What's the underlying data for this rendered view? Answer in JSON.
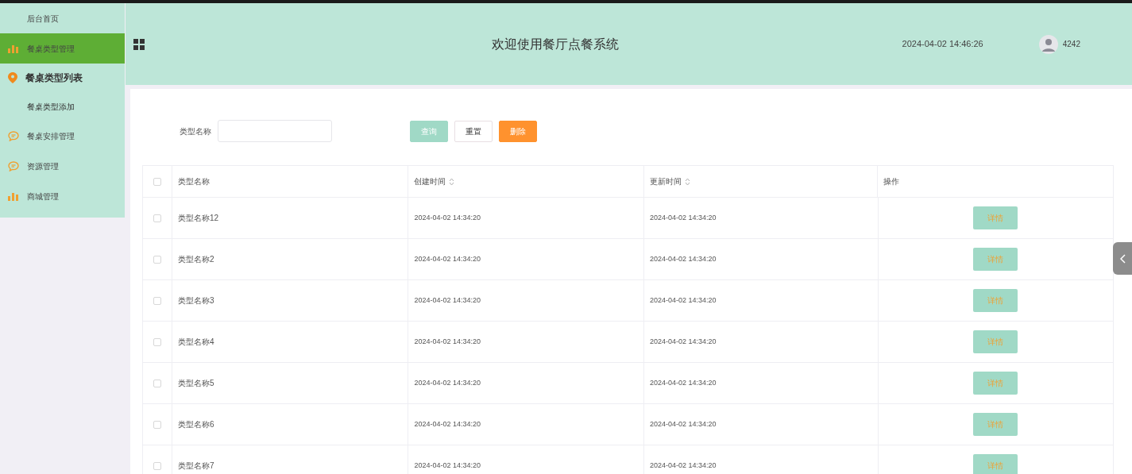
{
  "sidebar": {
    "items": [
      {
        "label": "后台首页",
        "selected": false
      },
      {
        "label": "餐桌类型管理",
        "selected": true,
        "children": [
          {
            "label": "餐桌类型列表",
            "selected": true
          },
          {
            "label": "餐桌类型添加",
            "selected": false
          }
        ]
      },
      {
        "label": "餐桌安排管理",
        "selected": false
      },
      {
        "label": "资源管理",
        "selected": false
      },
      {
        "label": "商城管理",
        "selected": false
      }
    ]
  },
  "header": {
    "title": "欢迎使用餐厅点餐系统",
    "datetime": "2024-04-02 14:46:26",
    "username": "4242"
  },
  "search": {
    "label": "类型名称",
    "buttons": [
      {
        "label": "查询",
        "kind": "query"
      },
      {
        "label": "重置",
        "kind": "reset"
      },
      {
        "label": "删除",
        "kind": "delete"
      }
    ]
  },
  "table": {
    "select_all": {
      "checked": false
    },
    "columns": [
      {
        "label": "类型名称",
        "sortable": false
      },
      {
        "label": "创建时间",
        "sortable": true
      },
      {
        "label": "更新时间",
        "sortable": true
      },
      {
        "label": "操作",
        "sortable": false
      }
    ],
    "rows": [
      {
        "checked": false,
        "name": "类型名称12",
        "created": "2024-04-02 14:34:20",
        "updated": "2024-04-02 14:34:20",
        "action": "详情"
      },
      {
        "checked": false,
        "name": "类型名称2",
        "created": "2024-04-02 14:34:20",
        "updated": "2024-04-02 14:34:20",
        "action": "详情"
      },
      {
        "checked": false,
        "name": "类型名称3",
        "created": "2024-04-02 14:34:20",
        "updated": "2024-04-02 14:34:20",
        "action": "详情"
      },
      {
        "checked": false,
        "name": "类型名称4",
        "created": "2024-04-02 14:34:20",
        "updated": "2024-04-02 14:34:20",
        "action": "详情"
      },
      {
        "checked": false,
        "name": "类型名称5",
        "created": "2024-04-02 14:34:20",
        "updated": "2024-04-02 14:34:20",
        "action": "详情"
      },
      {
        "checked": false,
        "name": "类型名称6",
        "created": "2024-04-02 14:34:20",
        "updated": "2024-04-02 14:34:20",
        "action": "详情"
      },
      {
        "checked": false,
        "name": "类型名称7",
        "created": "2024-04-02 14:34:20",
        "updated": "2024-04-02 14:34:20",
        "action": "详情"
      }
    ]
  }
}
